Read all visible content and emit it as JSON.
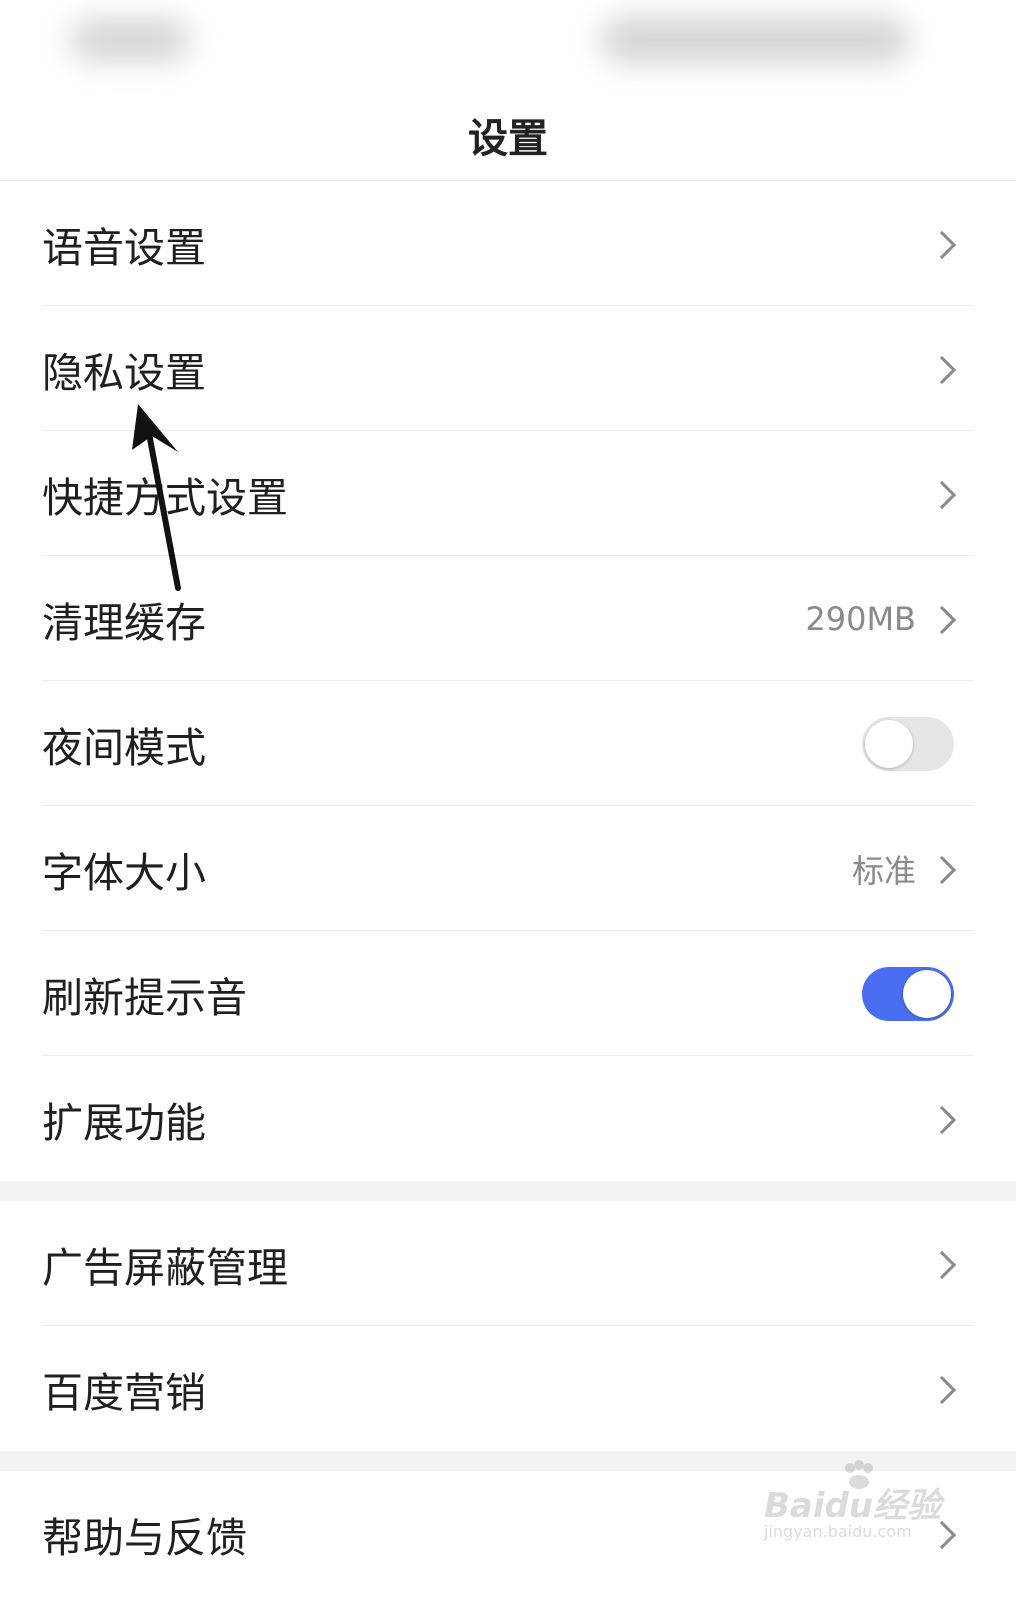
{
  "header": {
    "title": "设置"
  },
  "section1": [
    {
      "label": "语音设置",
      "type": "link"
    },
    {
      "label": "隐私设置",
      "type": "link"
    },
    {
      "label": "快捷方式设置",
      "type": "link"
    },
    {
      "label": "清理缓存",
      "type": "link",
      "value": "290MB"
    },
    {
      "label": "夜间模式",
      "type": "toggle",
      "on": false
    },
    {
      "label": "字体大小",
      "type": "link",
      "value": "标准"
    },
    {
      "label": "刷新提示音",
      "type": "toggle",
      "on": true
    },
    {
      "label": "扩展功能",
      "type": "link"
    }
  ],
  "section2": [
    {
      "label": "广告屏蔽管理",
      "type": "link"
    },
    {
      "label": "百度营销",
      "type": "link"
    }
  ],
  "section3": [
    {
      "label": "帮助与反馈",
      "type": "link"
    }
  ],
  "colors": {
    "toggle_on": "#4a6ef2",
    "toggle_off": "#e6e6e6",
    "value_text": "#8a8a8a"
  },
  "icons": [
    "chevron-right-icon",
    "annotation-arrow-icon"
  ],
  "watermark": {
    "logo": "Baidu经验",
    "url": "jingyan.baidu.com"
  }
}
